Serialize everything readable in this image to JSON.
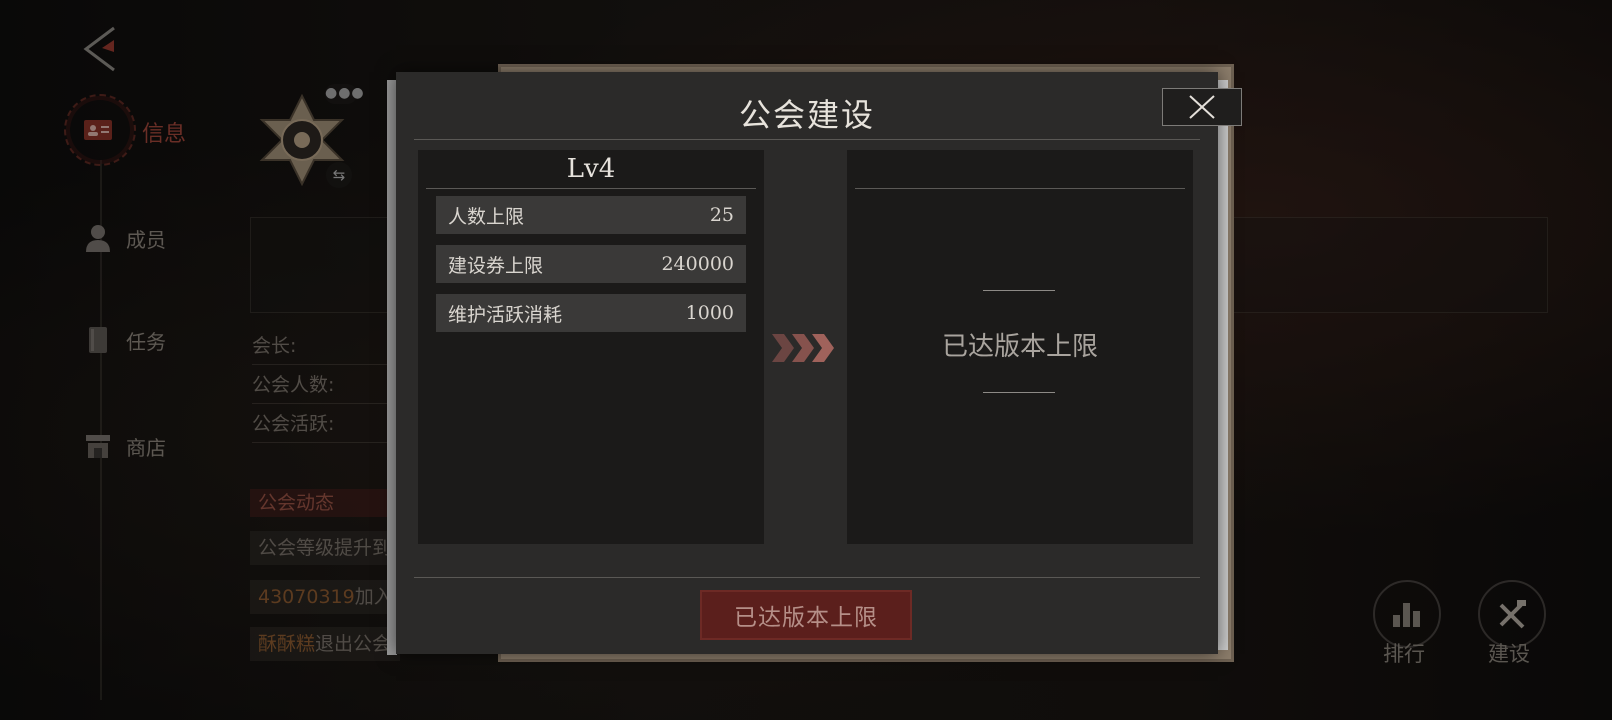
{
  "nav": {
    "info_label": "信息",
    "members_label": "成员",
    "tasks_label": "任务",
    "shop_label": "商店"
  },
  "guild_info": {
    "leader_label": "会长:",
    "member_count_label": "公会人数:",
    "activity_label": "公会活跃:"
  },
  "feed": {
    "title": "公会动态",
    "items": [
      {
        "highlight": "",
        "text": "公会等级提升到"
      },
      {
        "highlight": "43070319",
        "text": "加入公会"
      },
      {
        "highlight": "酥酥糕",
        "text": "退出公会"
      }
    ]
  },
  "bottom_buttons": {
    "rank_label": "排行",
    "build_label": "建设"
  },
  "modal": {
    "title": "公会建设",
    "current_level": "Lv4",
    "stats": [
      {
        "label": "人数上限",
        "value": "25"
      },
      {
        "label": "建设券上限",
        "value": "240000"
      },
      {
        "label": "维护活跃消耗",
        "value": "1000"
      }
    ],
    "next_level_text": "已达版本上限",
    "action_button_label": "已达版本上限"
  },
  "colors": {
    "accent_red": "#a4473b",
    "modal_bg": "#2b2a29",
    "button_red": "#5b1f1c"
  }
}
